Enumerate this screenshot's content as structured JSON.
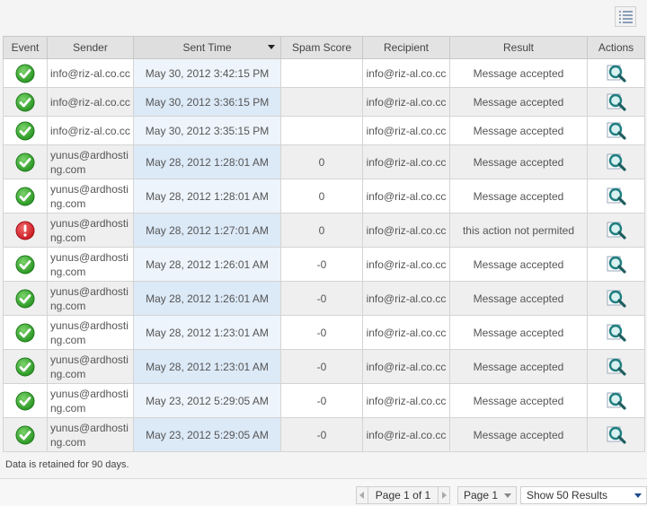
{
  "table": {
    "headers": {
      "event": "Event",
      "sender": "Sender",
      "sent_time": "Sent Time",
      "spam_score": "Spam Score",
      "recipient": "Recipient",
      "result": "Result",
      "actions": "Actions"
    },
    "rows": [
      {
        "event": "success",
        "sender": "info@riz-al.co.cc",
        "sent_time": "May 30, 2012 3:42:15 PM",
        "spam_score": "",
        "recipient": "info@riz-al.co.cc",
        "result": "Message accepted"
      },
      {
        "event": "success",
        "sender": "info@riz-al.co.cc",
        "sent_time": "May 30, 2012 3:36:15 PM",
        "spam_score": "",
        "recipient": "info@riz-al.co.cc",
        "result": "Message accepted"
      },
      {
        "event": "success",
        "sender": "info@riz-al.co.cc",
        "sent_time": "May 30, 2012 3:35:15 PM",
        "spam_score": "",
        "recipient": "info@riz-al.co.cc",
        "result": "Message accepted"
      },
      {
        "event": "success",
        "sender": "yunus@ardhosting.com",
        "sent_time": "May 28, 2012 1:28:01 AM",
        "spam_score": "0",
        "recipient": "info@riz-al.co.cc",
        "result": "Message accepted"
      },
      {
        "event": "success",
        "sender": "yunus@ardhosting.com",
        "sent_time": "May 28, 2012 1:28:01 AM",
        "spam_score": "0",
        "recipient": "info@riz-al.co.cc",
        "result": "Message accepted"
      },
      {
        "event": "error",
        "sender": "yunus@ardhosting.com",
        "sent_time": "May 28, 2012 1:27:01 AM",
        "spam_score": "0",
        "recipient": "info@riz-al.co.cc",
        "result": "this action not permited"
      },
      {
        "event": "success",
        "sender": "yunus@ardhosting.com",
        "sent_time": "May 28, 2012 1:26:01 AM",
        "spam_score": "-0",
        "recipient": "info@riz-al.co.cc",
        "result": "Message accepted"
      },
      {
        "event": "success",
        "sender": "yunus@ardhosting.com",
        "sent_time": "May 28, 2012 1:26:01 AM",
        "spam_score": "-0",
        "recipient": "info@riz-al.co.cc",
        "result": "Message accepted"
      },
      {
        "event": "success",
        "sender": "yunus@ardhosting.com",
        "sent_time": "May 28, 2012 1:23:01 AM",
        "spam_score": "-0",
        "recipient": "info@riz-al.co.cc",
        "result": "Message accepted"
      },
      {
        "event": "success",
        "sender": "yunus@ardhosting.com",
        "sent_time": "May 28, 2012 1:23:01 AM",
        "spam_score": "-0",
        "recipient": "info@riz-al.co.cc",
        "result": "Message accepted"
      },
      {
        "event": "success",
        "sender": "yunus@ardhosting.com",
        "sent_time": "May 23, 2012 5:29:05 AM",
        "spam_score": "-0",
        "recipient": "info@riz-al.co.cc",
        "result": "Message accepted"
      },
      {
        "event": "success",
        "sender": "yunus@ardhosting.com",
        "sent_time": "May 23, 2012 5:29:05 AM",
        "spam_score": "-0",
        "recipient": "info@riz-al.co.cc",
        "result": "Message accepted"
      }
    ]
  },
  "icons": {
    "success": "check-circle-icon",
    "error": "exclamation-circle-icon",
    "action": "magnifier-icon",
    "list_view": "list-view-icon"
  },
  "colors": {
    "success_green": "#2e9e2a",
    "error_red": "#d6202a",
    "action_teal": "#2a8a8a",
    "sort_column_bg": "#dce9f7"
  },
  "retention_note": "Data is retained for 90 days.",
  "pagination": {
    "status": "Page 1 of 1",
    "page_select": "Page 1",
    "results_select": "Show 50 Results"
  }
}
